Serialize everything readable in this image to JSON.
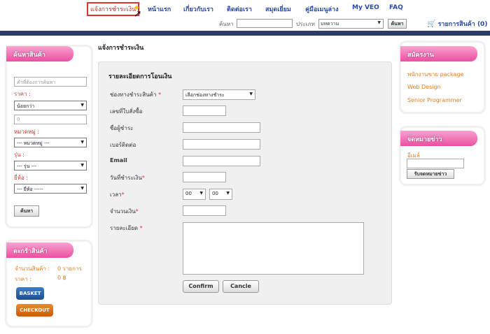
{
  "nav": {
    "items": [
      {
        "label": "แจ้งการชำระเงิน",
        "active": true
      },
      {
        "label": "หน้าแรก"
      },
      {
        "label": "เกี่ยวกับเรา"
      },
      {
        "label": "ติดต่อเรา"
      },
      {
        "label": "สมุดเยี่ยม"
      },
      {
        "label": "คู่มือเมนูล่าง"
      },
      {
        "label": "My VEO"
      },
      {
        "label": "FAQ"
      }
    ]
  },
  "searchbar": {
    "search_label": "ค้นหา",
    "type_label": "ประเภท",
    "type_value": "บทความ",
    "search_button": "ค้นหา",
    "cart_label": "รายการสินค้า (0)"
  },
  "left_search": {
    "title": "ค้นหาสินค้า",
    "keyword_placeholder": "คำที่ต้องการค้นหา",
    "price_label": "ราคา :",
    "price_select": "น้อยกว่า",
    "price_value": "0",
    "category_label": "หมวดหมู่ :",
    "category_select": "--- หมวดหมู่ ---",
    "model_label": "รุ่น :",
    "model_select": "--- รุ่น ---",
    "brand_label": "ยี่ห้อ :",
    "brand_select": "--- ยี่ห้อ -----",
    "search_button": "ค้นหา"
  },
  "cart_panel": {
    "title": "ตะกร้าสินค้า",
    "count_label": "จำนวนสินค้า :",
    "count_value": "0 รายการ",
    "price_label": "ราคา :",
    "price_value": "0 ฿",
    "basket_button": "BASKET",
    "checkout_button": "CHECKOUT"
  },
  "main": {
    "page_title": "แจ้งการชำระเงิน",
    "section_title": "รายละเอียดการโอนเงิน",
    "fields": {
      "channel_label": "ช่องทางชำระสินค้า",
      "channel_select": "เลือกช่องทางชำระ",
      "order_label": "เลขที่ใบสั่งซื้อ",
      "payer_label": "ชื่อผู้ชำระ",
      "phone_label": "เบอร์ติดต่อ",
      "email_label": "Email",
      "date_label": "วันที่ชำระเงิน",
      "time_label": "เวลา",
      "hour_value": "00",
      "minute_value": "00",
      "amount_label": "จำนวนเงิน",
      "detail_label": "รายละเอียด"
    },
    "confirm_button": "Confirm",
    "cancel_button": "Cancle"
  },
  "jobs": {
    "title": "สมัครงาน",
    "items": [
      "พนักงานขาย package",
      "Web Design",
      "Senior Programmer"
    ]
  },
  "newsletter": {
    "title": "จดหมายข่าว",
    "email_label": "อีเมล์",
    "subscribe_button": "รับจดหมายข่าว"
  },
  "colors": {
    "accent_pink": "#ea4fa1",
    "link_orange": "#e67e22",
    "nav_blue": "#2a4aa8",
    "band": "#2e3a66"
  }
}
